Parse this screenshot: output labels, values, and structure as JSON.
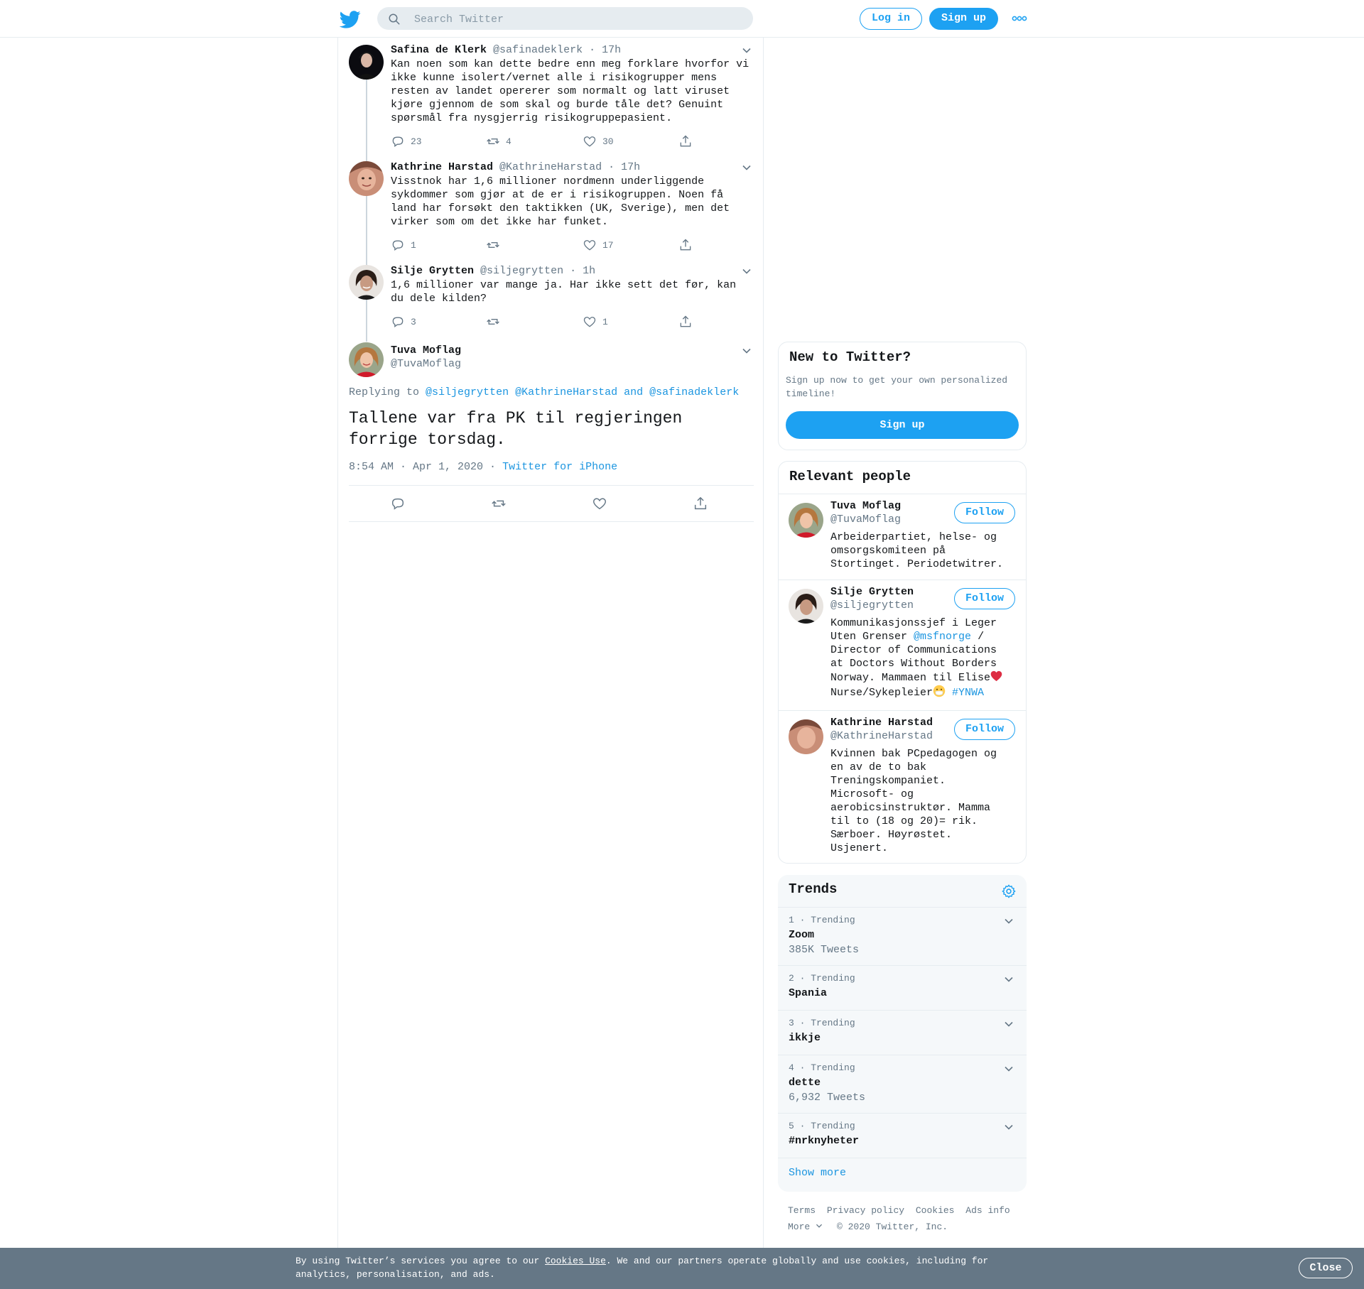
{
  "header": {
    "search_placeholder": "Search Twitter",
    "login_label": "Log in",
    "signup_label": "Sign up",
    "more_icon": "more-dots-icon",
    "logo_icon": "twitter-bird-icon"
  },
  "thread": [
    {
      "name": "Safina de Klerk",
      "handle": "@safinadeklerk",
      "time": "· 17h",
      "text": "Kan noen som kan dette bedre enn meg forklare hvorfor vi ikke kunne isolert/vernet alle i risikogrupper mens resten av landet opererer som normalt og latt viruset kjøre gjennom de som skal og burde tåle det? Genuint spørsmål fra nysgjerrig risikogruppepasient.",
      "replies": "23",
      "retweets": "4",
      "likes": "30"
    },
    {
      "name": "Kathrine Harstad",
      "handle": "@KathrineHarstad",
      "time": "· 17h",
      "text": "Visstnok har 1,6 millioner nordmenn underliggende sykdommer som gjør at de er i risikogruppen. Noen få land har forsøkt den taktikken (UK, Sverige), men det virker som om det ikke har funket.",
      "replies": "1",
      "retweets": "",
      "likes": "17"
    },
    {
      "name": "Silje Grytten",
      "handle": "@siljegrytten",
      "time": "· 1h",
      "text": "1,6 millioner var mange ja. Har ikke sett det før, kan du dele kilden?",
      "replies": "3",
      "retweets": "",
      "likes": "1"
    }
  ],
  "main_tweet": {
    "name": "Tuva Moflag",
    "handle": "@TuvaMoflag",
    "replying_prefix": "Replying to",
    "replying_to_1": "@siljegrytten",
    "replying_to_2": "@KathrineHarstad",
    "replying_and": "and",
    "replying_to_3": "@safinadeklerk",
    "text": "Tallene var fra PK til regjeringen forrige torsdag.",
    "timestamp": "8:54 AM · Apr 1, 2020 ·",
    "source": "Twitter for iPhone"
  },
  "new_to_twitter": {
    "title": "New to Twitter?",
    "text": "Sign up now to get your own personalized timeline!",
    "button": "Sign up"
  },
  "relevant_people": {
    "title": "Relevant people",
    "follow_label": "Follow",
    "people": [
      {
        "name": "Tuva Moflag",
        "handle": "@TuvaMoflag",
        "bio": "Arbeiderpartiet, helse- og omsorgskomiteen på Stortinget. Periodetwitrer."
      },
      {
        "name": "Silje Grytten",
        "handle": "@siljegrytten",
        "bio_1": "Kommunikasjonssjef i Leger Uten Grenser",
        "bio_link": "@msfnorge",
        "bio_2": "/ Director of Communications at Doctors Without Borders Norway. Mammaen til Elise",
        "bio_3": "Nurse/Sykepleier",
        "bio_tag": "#YNWA"
      },
      {
        "name": "Kathrine Harstad",
        "handle": "@KathrineHarstad",
        "bio": "Kvinnen bak PCpedagogen og en av de to bak Treningskompaniet. Microsoft- og aerobicsinstruktør. Mamma til to (18 og 20)= rik. Særboer. Høyrøstet. Usjenert."
      }
    ]
  },
  "trends": {
    "title": "Trends",
    "items": [
      {
        "meta": "1 · Trending",
        "name": "Zoom",
        "count": "385K Tweets"
      },
      {
        "meta": "2 · Trending",
        "name": "Spania",
        "count": ""
      },
      {
        "meta": "3 · Trending",
        "name": "ikkje",
        "count": ""
      },
      {
        "meta": "4 · Trending",
        "name": "dette",
        "count": "6,932 Tweets"
      },
      {
        "meta": "5 · Trending",
        "name": "#nrknyheter",
        "count": ""
      }
    ],
    "show_more": "Show more"
  },
  "footer": {
    "terms": "Terms",
    "privacy": "Privacy policy",
    "cookies": "Cookies",
    "ads": "Ads info",
    "more": "More",
    "copyright": "© 2020 Twitter, Inc."
  },
  "cookie_bar": {
    "text_1": "By using Twitter’s services you agree to our",
    "link": "Cookies Use",
    "text_2": ". We and our partners operate globally and use cookies, including for analytics, personalisation, and ads.",
    "close": "Close"
  },
  "colors": {
    "accent": "#1da1f2",
    "link": "#1b95e0",
    "muted": "#657786",
    "cookie_bg": "#657786"
  }
}
